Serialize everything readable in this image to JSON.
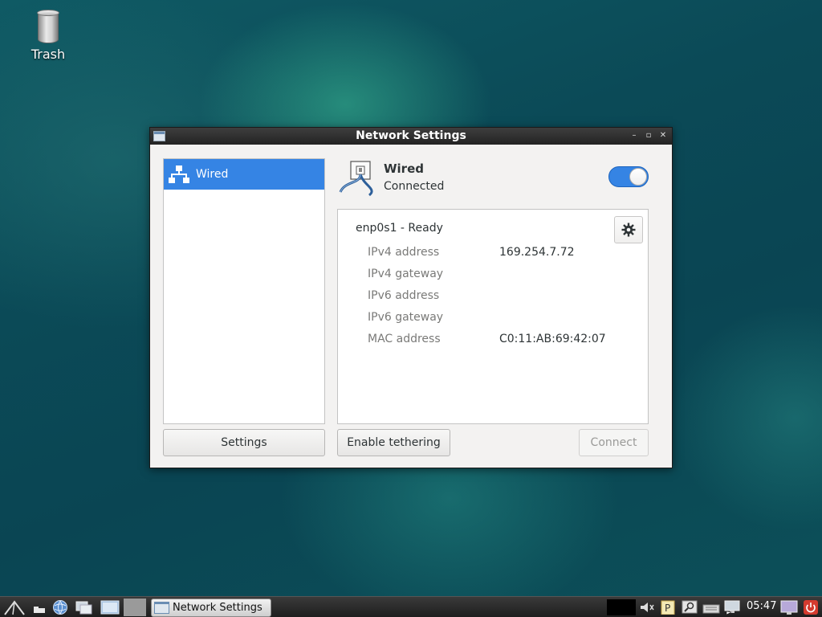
{
  "desktop": {
    "trash_label": "Trash"
  },
  "window": {
    "title": "Network Settings",
    "controls": [
      "minimize-icon",
      "maximize-icon",
      "close-icon"
    ],
    "sidebar": {
      "items": [
        {
          "label": "Wired",
          "icon": "network-icon",
          "selected": true
        }
      ],
      "settings_button": "Settings"
    },
    "header": {
      "title": "Wired",
      "status": "Connected",
      "toggle_on": true
    },
    "device": {
      "name": "enp0s1 - Ready",
      "details": [
        {
          "label": "IPv4 address",
          "value": "169.254.7.72"
        },
        {
          "label": "IPv4 gateway",
          "value": ""
        },
        {
          "label": "IPv6 address",
          "value": ""
        },
        {
          "label": "IPv6 gateway",
          "value": ""
        },
        {
          "label": "MAC address",
          "value": "C0:11:AB:69:42:07"
        }
      ]
    },
    "buttons": {
      "tethering": "Enable tethering",
      "connect": "Connect"
    }
  },
  "taskbar": {
    "task_label": "Network Settings",
    "clock": "05:47"
  },
  "colors": {
    "accent": "#3584e4",
    "titlebar": "#2b2b2b"
  }
}
